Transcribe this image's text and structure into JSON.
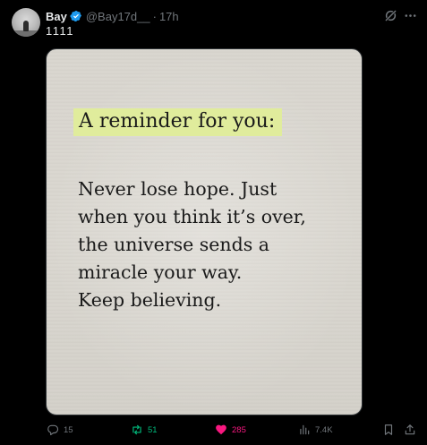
{
  "tweet": {
    "author_name": "Bay",
    "handle": "@Bay17d__",
    "separator": "·",
    "time": "17h",
    "text": "1111"
  },
  "image": {
    "heading": "A reminder for you:",
    "lines": [
      "Never lose hope. Just",
      "when you think it’s over,",
      "the universe sends a",
      "miracle your way.",
      "Keep believing."
    ]
  },
  "actions": {
    "replies": "15",
    "reposts": "51",
    "likes": "285",
    "views": "7.4K"
  },
  "colors": {
    "background": "#000000",
    "verified": "#1d9bf0",
    "repost_active": "#00ba7c",
    "like_active": "#f91880",
    "muted": "#71767b",
    "highlight": "#e0ec9c"
  },
  "icons": {
    "verified": "verified-badge-icon",
    "grok": "grok-icon",
    "more": "more-icon",
    "reply": "reply-icon",
    "repost": "repost-icon",
    "like": "heart-icon",
    "views": "views-icon",
    "bookmark": "bookmark-icon",
    "share": "share-icon"
  }
}
